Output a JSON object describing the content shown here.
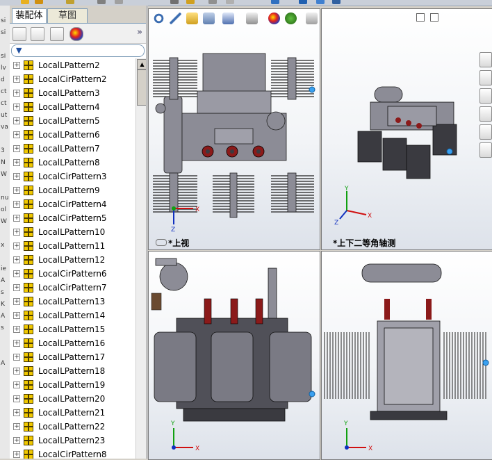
{
  "left_strip_chars": [
    "",
    "si",
    "si",
    "",
    "si",
    "lv",
    "d",
    "ct",
    "ct",
    "ut",
    "va",
    "",
    "3",
    "N",
    "W",
    "",
    "nu",
    "ol",
    "W",
    "",
    "x",
    "",
    "ie",
    "A",
    "s",
    "K",
    "A",
    "s",
    "",
    "",
    "A",
    ""
  ],
  "panel": {
    "tabs": [
      {
        "label": "装配体",
        "active": true
      },
      {
        "label": "草图",
        "active": false
      }
    ],
    "expand_glyph": "»",
    "filter_glyph": "▼"
  },
  "tree": {
    "items": [
      "LocalLPattern2",
      "LocalCirPattern2",
      "LocalLPattern3",
      "LocalLPattern4",
      "LocalLPattern5",
      "LocalLPattern6",
      "LocalLPattern7",
      "LocalLPattern8",
      "LocalCirPattern3",
      "LocalLPattern9",
      "LocalCirPattern4",
      "LocalCirPattern5",
      "LocalLPattern10",
      "LocalLPattern11",
      "LocalLPattern12",
      "LocalCirPattern6",
      "LocalCirPattern7",
      "LocalLPattern13",
      "LocalLPattern14",
      "LocalLPattern15",
      "LocalLPattern16",
      "LocalLPattern17",
      "LocalLPattern18",
      "LocalLPattern19",
      "LocalLPattern20",
      "LocalLPattern21",
      "LocalLPattern22",
      "LocalLPattern23",
      "LocalCirPattern8"
    ]
  },
  "viewports": {
    "top_left": {
      "label": "*上视",
      "axis_x": "X",
      "axis_y": "Y",
      "axis_z": "Z"
    },
    "top_right": {
      "label": "*上下二等角轴测",
      "axis_x": "X",
      "axis_y": "Y",
      "axis_z": "Z"
    },
    "bottom_left": {
      "axis_x": "X",
      "axis_y": "Y"
    },
    "bottom_right": {
      "axis_x": "X",
      "axis_y": "Y"
    }
  },
  "colors": {
    "model_gray": "#8c8c96",
    "model_dark": "#3a3a40",
    "accent_red": "#8b1a1a",
    "axis_x": "#d01010",
    "axis_y": "#10a010",
    "axis_z": "#1030c0"
  }
}
